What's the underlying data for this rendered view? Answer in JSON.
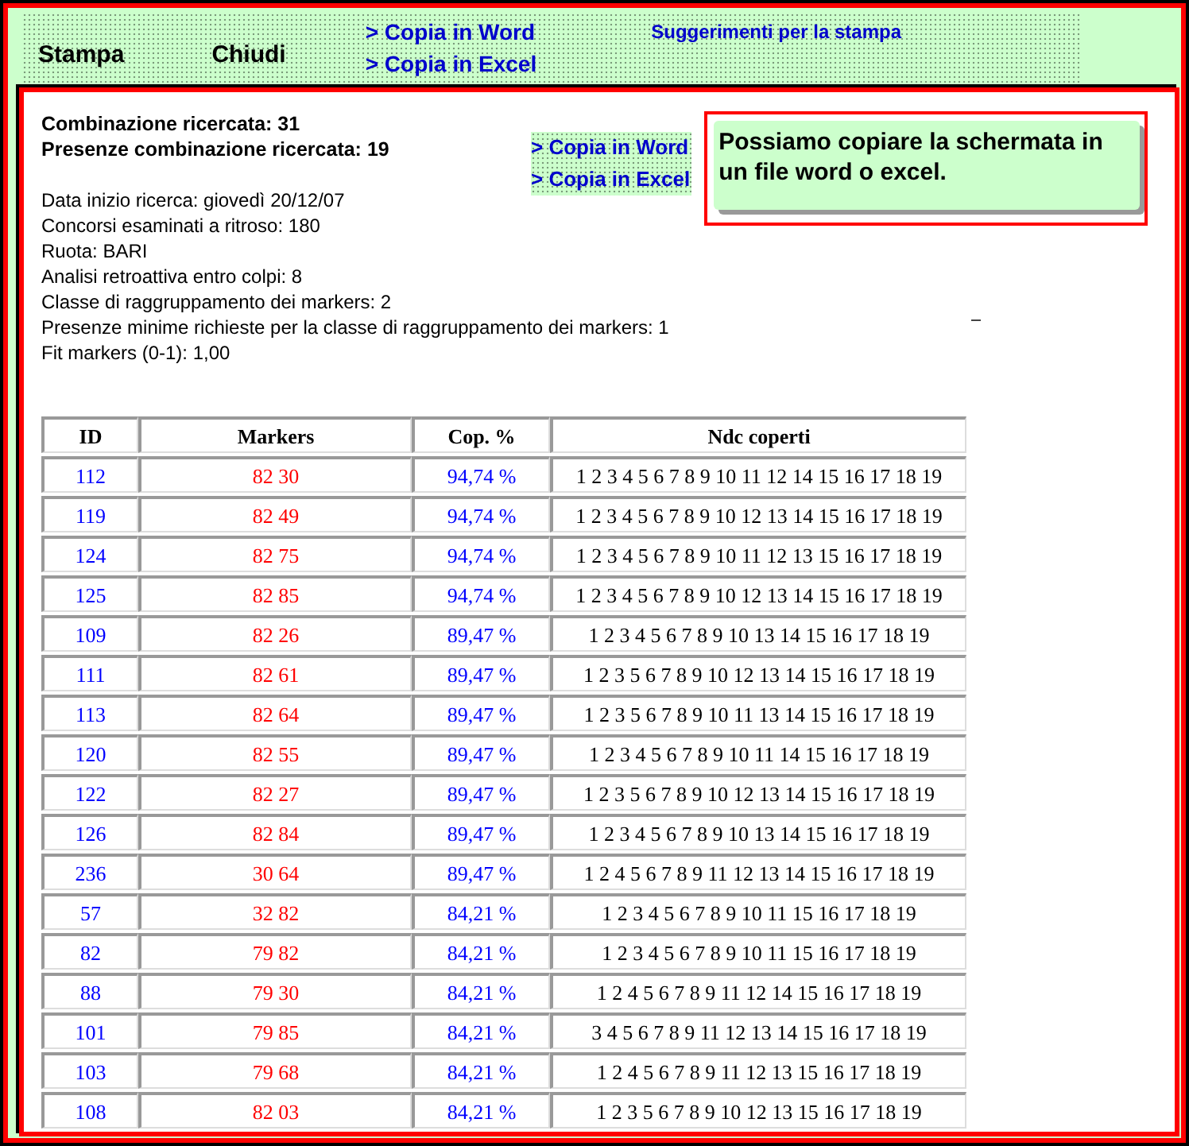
{
  "toolbar": {
    "buttons": [
      "Stampa",
      "Chiudi"
    ],
    "links": [
      "> Copia in Word",
      "> Copia in Excel"
    ],
    "tips_link": "Suggerimenti per la stampa"
  },
  "summary": {
    "headline": [
      "Combinazione ricercata: 31",
      "Presenze combinazione ricercata: 19"
    ],
    "links": [
      "> Copia in Word",
      "> Copia in Excel"
    ],
    "params": [
      "Data inizio ricerca: giovedì 20/12/07",
      "Concorsi esaminati a ritroso: 180",
      "Ruota: BARI",
      "Analisi retroattiva entro colpi: 8",
      "Classe di raggruppamento dei markers: 2",
      "Presenze minime richieste per la classe di raggruppamento dei markers: 1",
      "Fit markers (0-1): 1,00"
    ]
  },
  "callout": {
    "text": "Possiamo copiare la schermata in un file word o excel."
  },
  "table": {
    "columns": [
      "ID",
      "Markers",
      "Cop. %",
      "Ndc coperti"
    ],
    "rows": [
      {
        "id": "112",
        "markers": "82 30",
        "cop": "94,74 %",
        "ndc": "1 2 3 4 5 6 7 8 9 10 11 12 14 15 16 17 18 19"
      },
      {
        "id": "119",
        "markers": "82 49",
        "cop": "94,74 %",
        "ndc": "1 2 3 4 5 6 7 8 9 10 12 13 14 15 16 17 18 19"
      },
      {
        "id": "124",
        "markers": "82 75",
        "cop": "94,74 %",
        "ndc": "1 2 3 4 5 6 7 8 9 10 11 12 13 15 16 17 18 19"
      },
      {
        "id": "125",
        "markers": "82 85",
        "cop": "94,74 %",
        "ndc": "1 2 3 4 5 6 7 8 9 10 12 13 14 15 16 17 18 19"
      },
      {
        "id": "109",
        "markers": "82 26",
        "cop": "89,47 %",
        "ndc": "1 2 3 4 5 6 7 8 9 10 13 14 15 16 17 18 19"
      },
      {
        "id": "111",
        "markers": "82 61",
        "cop": "89,47 %",
        "ndc": "1 2 3 5 6 7 8 9 10 12 13 14 15 16 17 18 19"
      },
      {
        "id": "113",
        "markers": "82 64",
        "cop": "89,47 %",
        "ndc": "1 2 3 5 6 7 8 9 10 11 13 14 15 16 17 18 19"
      },
      {
        "id": "120",
        "markers": "82 55",
        "cop": "89,47 %",
        "ndc": "1 2 3 4 5 6 7 8 9 10 11 14 15 16 17 18 19"
      },
      {
        "id": "122",
        "markers": "82 27",
        "cop": "89,47 %",
        "ndc": "1 2 3 5 6 7 8 9 10 12 13 14 15 16 17 18 19"
      },
      {
        "id": "126",
        "markers": "82 84",
        "cop": "89,47 %",
        "ndc": "1 2 3 4 5 6 7 8 9 10 13 14 15 16 17 18 19"
      },
      {
        "id": "236",
        "markers": "30 64",
        "cop": "89,47 %",
        "ndc": "1 2 4 5 6 7 8 9 11 12 13 14 15 16 17 18 19"
      },
      {
        "id": "57",
        "markers": "32 82",
        "cop": "84,21 %",
        "ndc": "1 2 3 4 5 6 7 8 9 10 11 15 16 17 18 19"
      },
      {
        "id": "82",
        "markers": "79 82",
        "cop": "84,21 %",
        "ndc": "1 2 3 4 5 6 7 8 9 10 11 15 16 17 18 19"
      },
      {
        "id": "88",
        "markers": "79 30",
        "cop": "84,21 %",
        "ndc": "1 2 4 5 6 7 8 9 11 12 14 15 16 17 18 19"
      },
      {
        "id": "101",
        "markers": "79 85",
        "cop": "84,21 %",
        "ndc": "3 4 5 6 7 8 9 11 12 13 14 15 16 17 18 19"
      },
      {
        "id": "103",
        "markers": "79 68",
        "cop": "84,21 %",
        "ndc": "1 2 4 5 6 7 8 9 11 12 13 15 16 17 18 19"
      },
      {
        "id": "108",
        "markers": "82 03",
        "cop": "84,21 %",
        "ndc": "1 2 3 5 6 7 8 9 10 12 13 15 16 17 18 19"
      }
    ]
  }
}
